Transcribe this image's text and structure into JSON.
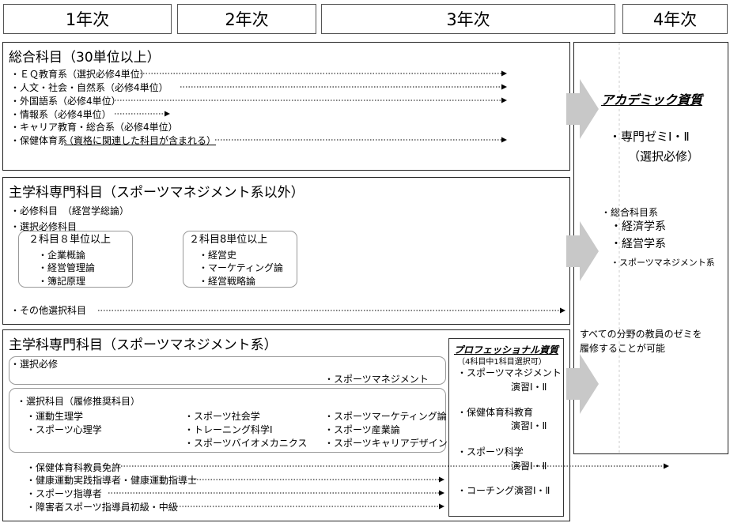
{
  "years": [
    "1年次",
    "2年次",
    "3年次",
    "4年次"
  ],
  "general": {
    "title": "総合科目（30単位以上）",
    "items": [
      "・ＥＱ教育系（選択必修4単位）",
      "・人文・社会・自然系（必修4単位）",
      "・外国語系（必修4単位）",
      "・情報系（必修4単位）",
      "・キャリア教育・総合系（必修4単位）",
      "・保健体育系",
      "（資格に関連した科目が含まれる）"
    ]
  },
  "major_other": {
    "title": "主学科専門科目（スポーツマネジメント系以外）",
    "required": "・必修科目　（経営学総論）",
    "elective": "・選択必修科目",
    "group1": {
      "title": "２科目８単位以上",
      "items": [
        "・企業概論",
        "・経営管理論",
        "・簿記原理"
      ]
    },
    "group2": {
      "title": "２科目8単位以上",
      "items": [
        "・経営史",
        "・マーケティング論",
        "・経営戦略論"
      ]
    },
    "others": "・その他選択科目"
  },
  "major_sports": {
    "title": "主学科専門科目（スポーツマネジメント系）",
    "required_label": "・選択必修",
    "required_item": "・スポーツマネジメント",
    "elective_label": "・選択科目（履修推奨科目）",
    "col1": [
      "・運動生理学",
      "・スポーツ心理学"
    ],
    "col2": [
      "・スポーツ社会学",
      "・トレーニング科学Ⅰ",
      "・スポーツバイオメカニクス"
    ],
    "col3": [
      "・スポーツマーケティング論",
      "・スポーツ産業論",
      "・スポーツキャリアデザイン"
    ],
    "licenses": [
      "・保健体育科教員免許",
      "・健康運動実践指導者・健康運動指導士",
      "・スポーツ指導者",
      "・障害者スポーツ指導員初級・中級"
    ]
  },
  "professional": {
    "title": "プロフェッショナル資質",
    "note": "（4科目中1科目選択可）",
    "items": [
      [
        "・スポーツマネジメント",
        "演習Ⅰ・Ⅱ"
      ],
      [
        "・保健体育科教育",
        "演習Ⅰ・Ⅱ"
      ],
      [
        "・スポーツ科学",
        "演習Ⅰ・Ⅱ"
      ],
      [
        "・コーチング演習Ⅰ・Ⅱ",
        ""
      ]
    ]
  },
  "academic": {
    "title": "アカデミック資質",
    "seminar1": "・専門ゼミⅠ・Ⅱ",
    "seminar2": "（選択必修）",
    "general_label": "・総合科目系",
    "general_items": [
      "・経済学系",
      "・経営学系"
    ],
    "sports_item": "・スポーツマネジメント系",
    "note1": "すべての分野の教員のゼミを",
    "note2": "履修することが可能"
  }
}
